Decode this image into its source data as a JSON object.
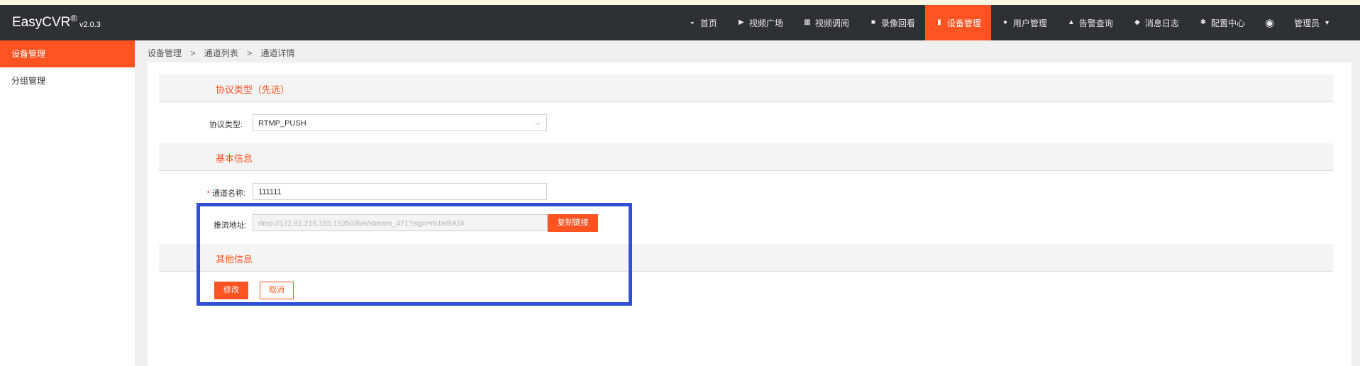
{
  "app": {
    "name": "EasyCVR",
    "registered": "®",
    "version": "v2.0.3"
  },
  "nav": {
    "items": [
      {
        "label": "首页",
        "icon": "dashboard-icon"
      },
      {
        "label": "视频广场",
        "icon": "play-circle-icon"
      },
      {
        "label": "视频调阅",
        "icon": "layout-icon"
      },
      {
        "label": "录像回看",
        "icon": "video-camera-icon"
      },
      {
        "label": "设备管理",
        "icon": "device-icon",
        "active": true
      },
      {
        "label": "用户管理",
        "icon": "user-icon"
      },
      {
        "label": "告警查询",
        "icon": "alarm-icon"
      },
      {
        "label": "消息日志",
        "icon": "bell-small-icon"
      },
      {
        "label": "配置中心",
        "icon": "gear-icon"
      }
    ],
    "notification_icon": "bell-icon",
    "user_label": "管理员"
  },
  "sidebar": {
    "items": [
      {
        "label": "设备管理",
        "active": true
      },
      {
        "label": "分组管理"
      }
    ]
  },
  "breadcrumb": {
    "items": [
      "设备管理",
      "通道列表",
      "通道详情"
    ],
    "separator": ">"
  },
  "form": {
    "section_protocol": "协议类型（先选）",
    "protocol_label": "协议类型:",
    "protocol_value": "RTMP_PUSH",
    "section_basic": "基本信息",
    "required_mark": "*",
    "channel_name_label": "通道名称:",
    "channel_name_value": "111111",
    "push_url_label": "推流地址:",
    "push_url_value": "rtmp://172.81.216.155:19350/live/stream_471?sign=rh1wBA1k",
    "copy_button": "复制链接",
    "section_other": "其他信息",
    "submit_button": "修改",
    "cancel_button": "取消"
  },
  "colors": {
    "accent": "#ff5322",
    "topbar": "#2d3136",
    "highlight_box": "#2f4fd4"
  }
}
